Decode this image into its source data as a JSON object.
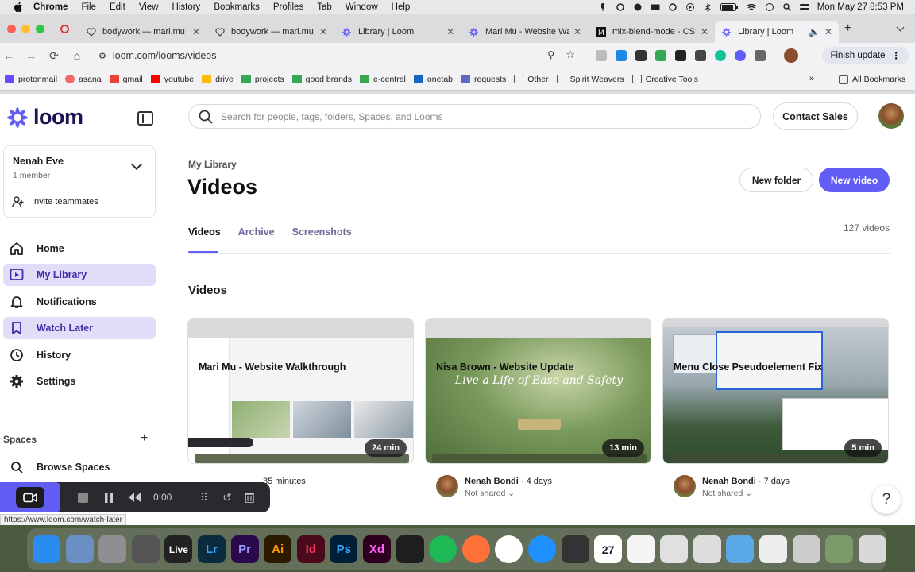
{
  "menubar": {
    "app": "Chrome",
    "items": [
      "File",
      "Edit",
      "View",
      "History",
      "Bookmarks",
      "Profiles",
      "Tab",
      "Window",
      "Help"
    ],
    "clock": "Mon May 27  8:53 PM"
  },
  "tabs": [
    {
      "title": "bodywork — mari.mu",
      "icon": "heart-icon"
    },
    {
      "title": "bodywork — mari.mu",
      "icon": "heart-icon"
    },
    {
      "title": "Library | Loom",
      "icon": "loom-icon"
    },
    {
      "title": "Mari Mu - Website Wal",
      "icon": "loom-icon"
    },
    {
      "title": "mix-blend-mode - CSS",
      "icon": "mdn-icon"
    },
    {
      "title": "Library | Loom",
      "icon": "loom-icon"
    }
  ],
  "toolbar": {
    "url": "loom.com/looms/videos",
    "finish_update": "Finish update"
  },
  "bookmarks": [
    {
      "label": "protonmail",
      "color": "#6d4aff"
    },
    {
      "label": "asana",
      "color": "#f06a6a"
    },
    {
      "label": "gmail",
      "color": "#ea4335"
    },
    {
      "label": "youtube",
      "color": "#ff0000"
    },
    {
      "label": "drive",
      "color": "#fbbc04"
    },
    {
      "label": "projects",
      "color": "#34a853"
    },
    {
      "label": "good brands",
      "color": "#34a853"
    },
    {
      "label": "e-central",
      "color": "#34a853"
    },
    {
      "label": "onetab",
      "color": "#1565c0"
    },
    {
      "label": "requests",
      "color": "#5c6bc0"
    },
    {
      "label": "Other",
      "color": "#777777"
    },
    {
      "label": "Spirit Weavers",
      "color": "#777777"
    },
    {
      "label": "Creative Tools",
      "color": "#777777"
    }
  ],
  "all_bookmarks": "All Bookmarks",
  "brand": {
    "name": "loom",
    "accent": "#625df5",
    "dark": "#1a1452"
  },
  "workspace": {
    "name": "Nenah Eve",
    "members": "1 member",
    "invite": "Invite teammates"
  },
  "nav": [
    {
      "label": "Home",
      "icon": "home-icon",
      "active": false
    },
    {
      "label": "My Library",
      "icon": "library-icon",
      "active": true
    },
    {
      "label": "Notifications",
      "icon": "bell-icon",
      "active": false
    },
    {
      "label": "Watch Later",
      "icon": "bookmark-icon",
      "active": true
    },
    {
      "label": "History",
      "icon": "clock-icon",
      "active": false
    },
    {
      "label": "Settings",
      "icon": "gear-icon",
      "active": false
    }
  ],
  "spaces": {
    "label": "Spaces",
    "browse": "Browse Spaces"
  },
  "recorder": {
    "time": "0:00"
  },
  "status_url": "https://www.loom.com/watch-later",
  "main": {
    "search_placeholder": "Search for people, tags, folders, Spaces, and Looms",
    "contact_sales": "Contact Sales",
    "breadcrumb": "My Library",
    "title": "Videos",
    "new_folder": "New folder",
    "new_video": "New video",
    "tabs": [
      "Videos",
      "Archive",
      "Screenshots"
    ],
    "video_count": "127 videos",
    "section": "Videos"
  },
  "videos": [
    {
      "duration": "24 min",
      "author": "",
      "age": "35 minutes",
      "shared": "",
      "title": "Mari Mu - Website Walkthrough"
    },
    {
      "duration": "13 min",
      "author": "Nenah Bondi",
      "age": "4 days",
      "shared": "Not shared",
      "title": "Nisa Brown - Website Update",
      "thumb_text": "Live a Life of Ease and Safety"
    },
    {
      "duration": "5 min",
      "author": "Nenah Bondi",
      "age": "7 days",
      "shared": "Not shared",
      "title": "Menu Close Pseudoelement Fix"
    }
  ],
  "dock": [
    {
      "name": "finder",
      "color": "#2b8cf0"
    },
    {
      "name": "preview",
      "color": "#6a8fc2"
    },
    {
      "name": "system-settings",
      "color": "#8e8e93"
    },
    {
      "name": "screenshot",
      "color": "#555555"
    },
    {
      "name": "live",
      "label": "Live",
      "color": "#222222"
    },
    {
      "name": "lightroom",
      "label": "Lr",
      "color": "#0b2b3f"
    },
    {
      "name": "premiere",
      "label": "Pr",
      "color": "#2a0a4a"
    },
    {
      "name": "illustrator",
      "label": "Ai",
      "color": "#2c1a00"
    },
    {
      "name": "indesign",
      "label": "Id",
      "color": "#4a0a1c"
    },
    {
      "name": "photoshop",
      "label": "Ps",
      "color": "#001e36"
    },
    {
      "name": "after-effects",
      "label": "Xd",
      "color": "#2e001f"
    },
    {
      "name": "figma",
      "color": "#1e1e1e"
    },
    {
      "name": "spotify",
      "color": "#1db954"
    },
    {
      "name": "firefox",
      "color": "#ff7139"
    },
    {
      "name": "chrome",
      "color": "#ffffff"
    },
    {
      "name": "safari",
      "color": "#1e90ff"
    },
    {
      "name": "calculator",
      "color": "#333333"
    },
    {
      "name": "calendar",
      "label": "27",
      "color": "#ffffff"
    },
    {
      "name": "textedit",
      "color": "#f5f5f5"
    },
    {
      "name": "launchpad",
      "color": "#e0e0e0"
    },
    {
      "name": "font-book",
      "color": "#dddddd"
    },
    {
      "name": "folder",
      "color": "#5aa9e6"
    },
    {
      "name": "document",
      "color": "#eeeeee"
    },
    {
      "name": "utilities",
      "color": "#cccccc"
    },
    {
      "name": "photo",
      "color": "#7a9a6a"
    },
    {
      "name": "trash",
      "color": "#d8d8d8"
    }
  ]
}
